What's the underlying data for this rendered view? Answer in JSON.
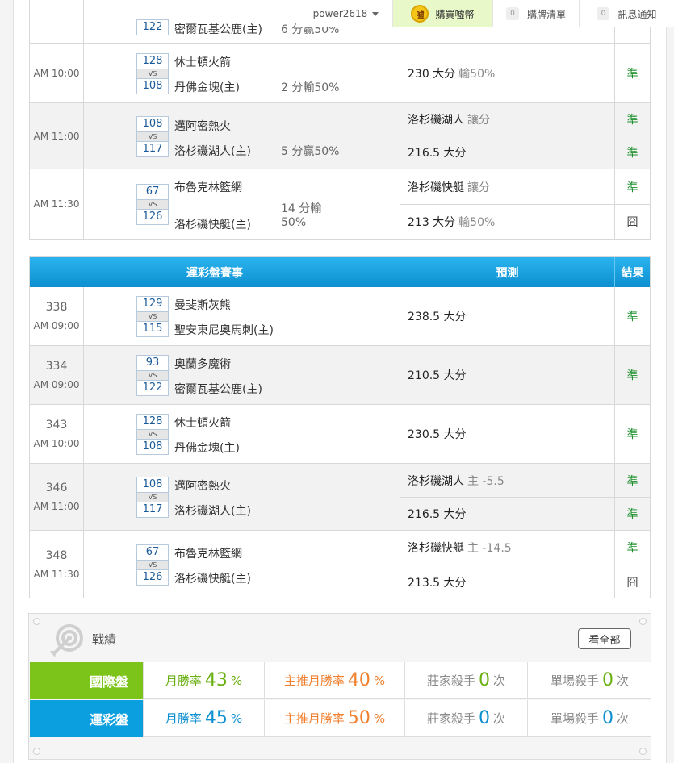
{
  "topbar": {
    "username": "power2618",
    "buy_label": "購買噓幣",
    "coin_glyph": "噓",
    "cart_count": "0",
    "cart_label": "購牌清單",
    "notice_count": "0",
    "notice_label": "訊息通知"
  },
  "table1": {
    "rows": [
      {
        "time": "",
        "home_score": "122",
        "home": "密爾瓦基公鹿(主)",
        "handicap": "6 分贏50%",
        "preds": []
      },
      {
        "time": "AM 10:00",
        "away_score": "128",
        "away": "休士頓火箭",
        "home_score": "108",
        "home": "丹佛金塊(主)",
        "handicap": "2 分輸50%",
        "preds": [
          {
            "main": "230 大分",
            "sub": "輸50%",
            "result": "準"
          }
        ]
      },
      {
        "time": "AM 11:00",
        "away_score": "108",
        "away": "邁阿密熱火",
        "home_score": "117",
        "home": "洛杉磯湖人(主)",
        "handicap": "5 分贏50%",
        "preds": [
          {
            "main": "洛杉磯湖人",
            "sub": "讓分",
            "result": "準"
          },
          {
            "main": "216.5 大分",
            "sub": "",
            "result": "準"
          }
        ]
      },
      {
        "time": "AM 11:30",
        "away_score": "67",
        "away": "布魯克林籃網",
        "home_score": "126",
        "home": "洛杉磯快艇(主)",
        "handicap_a": "14 分輸",
        "handicap_b": "50%",
        "preds": [
          {
            "main": "洛杉磯快艇",
            "sub": "讓分",
            "result": "準"
          },
          {
            "main": "213 大分",
            "sub": "輸50%",
            "result": "囧"
          }
        ]
      }
    ]
  },
  "table2": {
    "header": {
      "match": "運彩盤賽事",
      "pred": "預測",
      "result": "結果"
    },
    "rows": [
      {
        "num": "338",
        "time": "AM 09:00",
        "away_score": "129",
        "away": "曼斐斯灰熊",
        "home_score": "115",
        "home": "聖安東尼奧馬刺(主)",
        "preds": [
          {
            "main": "238.5 大分",
            "sub": "",
            "result": "準"
          }
        ]
      },
      {
        "num": "334",
        "time": "AM 09:00",
        "away_score": "93",
        "away": "奧蘭多魔術",
        "home_score": "122",
        "home": "密爾瓦基公鹿(主)",
        "preds": [
          {
            "main": "210.5 大分",
            "sub": "",
            "result": "準"
          }
        ]
      },
      {
        "num": "343",
        "time": "AM 10:00",
        "away_score": "128",
        "away": "休士頓火箭",
        "home_score": "108",
        "home": "丹佛金塊(主)",
        "preds": [
          {
            "main": "230.5 大分",
            "sub": "",
            "result": "準"
          }
        ]
      },
      {
        "num": "346",
        "time": "AM 11:00",
        "away_score": "108",
        "away": "邁阿密熱火",
        "home_score": "117",
        "home": "洛杉磯湖人(主)",
        "preds": [
          {
            "main": "洛杉磯湖人",
            "sub": "主 -5.5",
            "result": "準"
          },
          {
            "main": "216.5 大分",
            "sub": "",
            "result": "準"
          }
        ]
      },
      {
        "num": "348",
        "time": "AM 11:30",
        "away_score": "67",
        "away": "布魯克林籃網",
        "home_score": "126",
        "home": "洛杉磯快艇(主)",
        "preds": [
          {
            "main": "洛杉磯快艇",
            "sub": "主 -14.5",
            "result": "準"
          },
          {
            "main": "213.5 大分",
            "sub": "",
            "result": "囧"
          }
        ]
      }
    ]
  },
  "record": {
    "title": "戰績",
    "view_all": "看全部",
    "rows": [
      {
        "label": "國際盤",
        "monthly_label": "月勝率",
        "monthly": "43",
        "pct": "%",
        "top_label": "主推月勝率",
        "top": "40",
        "dealer_label": "莊家殺手",
        "dealer": "0",
        "single_label": "單場殺手",
        "single": "0",
        "unit": "次"
      },
      {
        "label": "運彩盤",
        "monthly_label": "月勝率",
        "monthly": "45",
        "pct": "%",
        "top_label": "主推月勝率",
        "top": "50",
        "dealer_label": "莊家殺手",
        "dealer": "0",
        "single_label": "單場殺手",
        "single": "0",
        "unit": "次"
      }
    ]
  },
  "colors": {
    "win": "#1a8f2a",
    "header_blue": "#0d8fd0",
    "green": "#7cc41a",
    "orange": "#f07f2e"
  },
  "icons": [
    "caret-down-icon",
    "coin-icon",
    "target-icon"
  ]
}
